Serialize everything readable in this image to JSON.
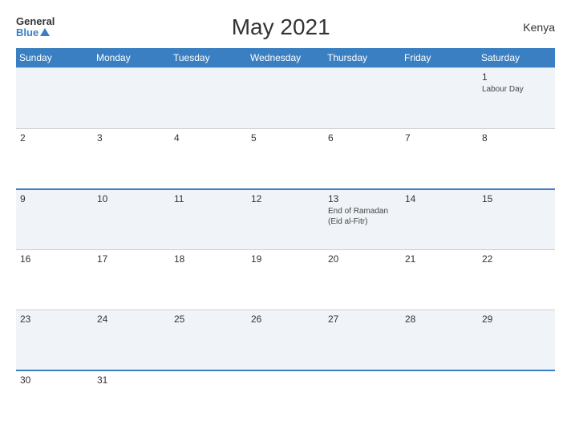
{
  "header": {
    "logo_general": "General",
    "logo_blue": "Blue",
    "title": "May 2021",
    "country": "Kenya"
  },
  "calendar": {
    "days_of_week": [
      "Sunday",
      "Monday",
      "Tuesday",
      "Wednesday",
      "Thursday",
      "Friday",
      "Saturday"
    ],
    "rows": [
      [
        {
          "day": "",
          "event": ""
        },
        {
          "day": "",
          "event": ""
        },
        {
          "day": "",
          "event": ""
        },
        {
          "day": "",
          "event": ""
        },
        {
          "day": "",
          "event": ""
        },
        {
          "day": "",
          "event": ""
        },
        {
          "day": "1",
          "event": "Labour Day"
        }
      ],
      [
        {
          "day": "2",
          "event": ""
        },
        {
          "day": "3",
          "event": ""
        },
        {
          "day": "4",
          "event": ""
        },
        {
          "day": "5",
          "event": ""
        },
        {
          "day": "6",
          "event": ""
        },
        {
          "day": "7",
          "event": ""
        },
        {
          "day": "8",
          "event": ""
        }
      ],
      [
        {
          "day": "9",
          "event": ""
        },
        {
          "day": "10",
          "event": ""
        },
        {
          "day": "11",
          "event": ""
        },
        {
          "day": "12",
          "event": ""
        },
        {
          "day": "13",
          "event": "End of Ramadan (Eid al-Fitr)"
        },
        {
          "day": "14",
          "event": ""
        },
        {
          "day": "15",
          "event": ""
        }
      ],
      [
        {
          "day": "16",
          "event": ""
        },
        {
          "day": "17",
          "event": ""
        },
        {
          "day": "18",
          "event": ""
        },
        {
          "day": "19",
          "event": ""
        },
        {
          "day": "20",
          "event": ""
        },
        {
          "day": "21",
          "event": ""
        },
        {
          "day": "22",
          "event": ""
        }
      ],
      [
        {
          "day": "23",
          "event": ""
        },
        {
          "day": "24",
          "event": ""
        },
        {
          "day": "25",
          "event": ""
        },
        {
          "day": "26",
          "event": ""
        },
        {
          "day": "27",
          "event": ""
        },
        {
          "day": "28",
          "event": ""
        },
        {
          "day": "29",
          "event": ""
        }
      ],
      [
        {
          "day": "30",
          "event": ""
        },
        {
          "day": "31",
          "event": ""
        },
        {
          "day": "",
          "event": ""
        },
        {
          "day": "",
          "event": ""
        },
        {
          "day": "",
          "event": ""
        },
        {
          "day": "",
          "event": ""
        },
        {
          "day": "",
          "event": ""
        }
      ]
    ]
  }
}
